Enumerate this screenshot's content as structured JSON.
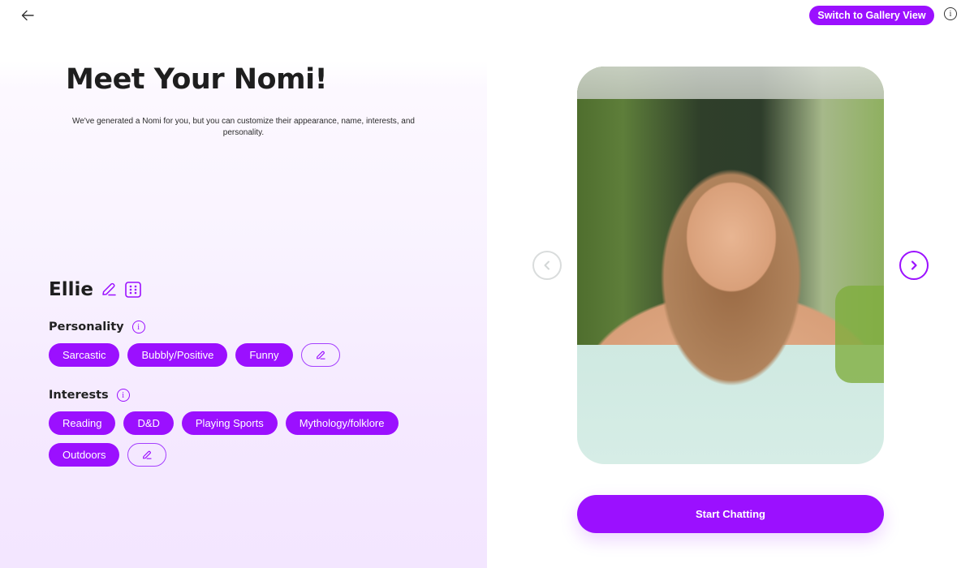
{
  "header": {
    "back_icon": "arrow-left-icon",
    "gallery_button_label": "Switch to Gallery View",
    "info_icon": "info-icon"
  },
  "intro": {
    "title": "Meet Your Nomi!",
    "subtitle": "We've generated a Nomi for you, but you can customize their appearance, name, interests, and personality."
  },
  "nomi": {
    "name": "Ellie",
    "edit_name_icon": "pencil-icon",
    "randomize_icon": "dice-icon"
  },
  "personality": {
    "label": "Personality",
    "info_icon": "info-icon",
    "traits": [
      "Sarcastic",
      "Bubbly/Positive",
      "Funny"
    ],
    "edit_icon": "pencil-icon"
  },
  "interests": {
    "label": "Interests",
    "info_icon": "info-icon",
    "items": [
      "Reading",
      "D&D",
      "Playing Sports",
      "Mythology/folklore",
      "Outdoors"
    ],
    "edit_icon": "pencil-icon"
  },
  "carousel": {
    "image_alt": "Generated Nomi portrait: young woman with long wavy light-brown hair wearing a mint spaghetti-strap top in a garden",
    "prev_icon": "chevron-left-circle-icon",
    "next_icon": "chevron-right-circle-icon",
    "prev_enabled": false,
    "next_enabled": true
  },
  "cta": {
    "start_label": "Start Chatting"
  },
  "colors": {
    "accent": "#9b10ff",
    "disabled_arrow": "#d9dcdc",
    "text_dark": "#1e1e1e",
    "panel_tint": "#f5e9ff"
  }
}
